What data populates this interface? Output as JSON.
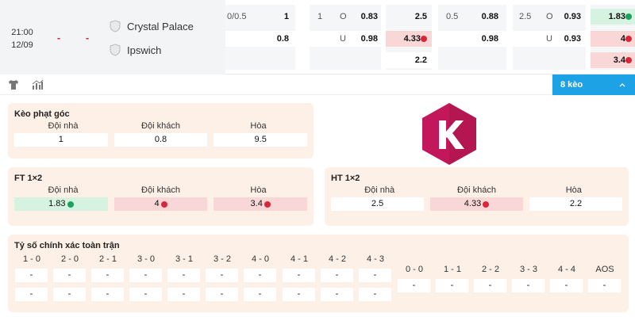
{
  "match": {
    "time": "21:00",
    "date": "12/09",
    "score_home": "-",
    "score_away": "-",
    "home_team": "Crystal Palace",
    "away_team": "Ipswich",
    "handicap": {
      "line": "0/0.5",
      "home": "1",
      "away": "0.8"
    },
    "over_under": {
      "line": "1",
      "over_label": "O",
      "over": "0.83",
      "under_label": "U",
      "under": "0.98"
    },
    "odds_1x2": {
      "home": "2.5",
      "away": "4.33",
      "draw": "2.2"
    },
    "h1_handicap": {
      "line": "0.5",
      "home": "0.88",
      "away": "0.98"
    },
    "h1_over_under": {
      "line": "2.5",
      "over_label": "O",
      "over": "0.93",
      "under_label": "U",
      "under": "0.93"
    },
    "h1_1x2": {
      "home": "1.83",
      "away": "4",
      "draw": "3.4"
    }
  },
  "toolbar": {
    "shirt_icon": "shirt-icon",
    "stats_icon": "stats-icon",
    "bets_label": "8 kèo"
  },
  "corner": {
    "title": "Kèo phạt góc",
    "headers": [
      "Đội nhà",
      "Đội khách",
      "Hòa"
    ],
    "values": [
      "1",
      "0.8",
      "9.5"
    ]
  },
  "ft": {
    "title": "FT 1×2",
    "headers": [
      "Đội nhà",
      "Đội khách",
      "Hòa"
    ],
    "values": [
      "1.83",
      "4",
      "3.4"
    ]
  },
  "ht": {
    "title": "HT 1×2",
    "headers": [
      "Đội nhà",
      "Đội khách",
      "Hòa"
    ],
    "values": [
      "2.5",
      "4.33",
      "2.2"
    ]
  },
  "correct_score": {
    "title": "Tỷ số chính xác toàn trận",
    "group1_headers": [
      "1 - 0",
      "2 - 0",
      "2 - 1",
      "3 - 0",
      "3 - 1",
      "3 - 2",
      "4 - 0",
      "4 - 1",
      "4 - 2",
      "4 - 3"
    ],
    "group1_row1": [
      "-",
      "-",
      "-",
      "-",
      "-",
      "-",
      "-",
      "-",
      "-",
      "-"
    ],
    "group1_row2": [
      "-",
      "-",
      "-",
      "-",
      "-",
      "-",
      "-",
      "-",
      "-",
      "-"
    ],
    "group2_headers": [
      "0 - 0",
      "1 - 1",
      "2 - 2",
      "3 - 3",
      "4 - 4",
      "AOS"
    ],
    "group2_row1": [
      "-",
      "-",
      "-",
      "-",
      "-",
      "-"
    ]
  },
  "colors": {
    "accent": "#1ea2e6",
    "panel_bg": "#fdf0e6",
    "up": "#1aa35a",
    "down": "#d9263a",
    "logo": "#c2185b"
  }
}
